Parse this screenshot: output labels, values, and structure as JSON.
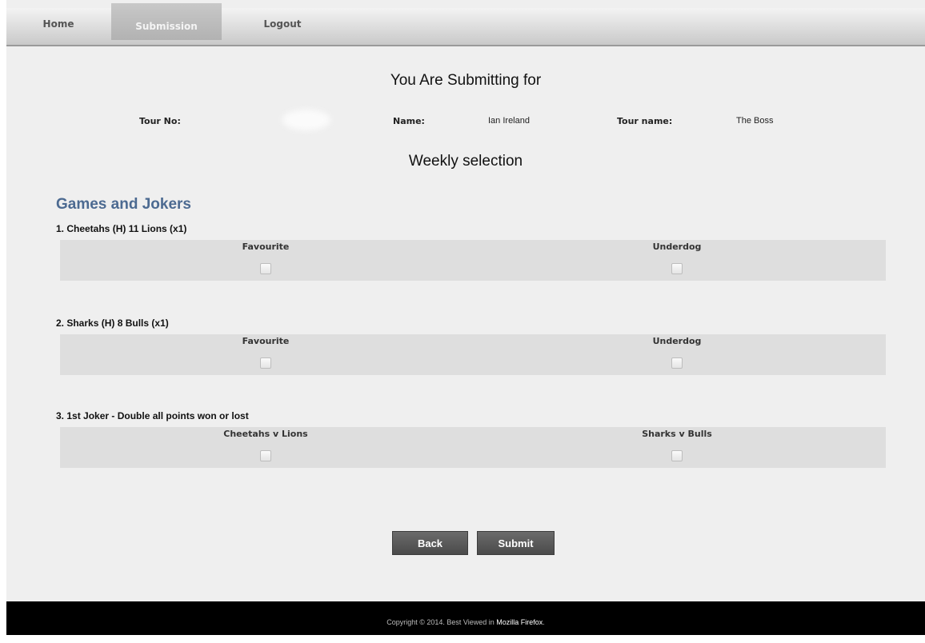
{
  "nav": {
    "home": "Home",
    "submission": "Submission",
    "logout": "Logout"
  },
  "header": {
    "title": "You Are Submitting for",
    "tour_no_label": "Tour No:",
    "name_label": "Name:",
    "name_value": "Ian Ireland",
    "tour_name_label": "Tour name:",
    "tour_name_value": "The Boss"
  },
  "weekly_title": "Weekly selection",
  "section_title": "Games and Jokers",
  "games": [
    {
      "prefix": "1. Cheetahs (H) ",
      "score": "11",
      "suffix": " Lions (x1)",
      "left_label": "Favourite",
      "right_label": "Underdog"
    },
    {
      "prefix": "2. Sharks (H) ",
      "score": "8",
      "suffix": " Bulls (x1)",
      "left_label": "Favourite",
      "right_label": "Underdog"
    },
    {
      "prefix": "3. 1st Joker - Double all points won or lost",
      "score": "",
      "suffix": "",
      "left_label": "Cheetahs v Lions",
      "right_label": "Sharks v Bulls"
    }
  ],
  "buttons": {
    "back": "Back",
    "submit": "Submit"
  },
  "footer": {
    "text": "Copyright © 2014. Best Viewed in ",
    "browser": "Mozilla Firefox",
    "end": "."
  }
}
